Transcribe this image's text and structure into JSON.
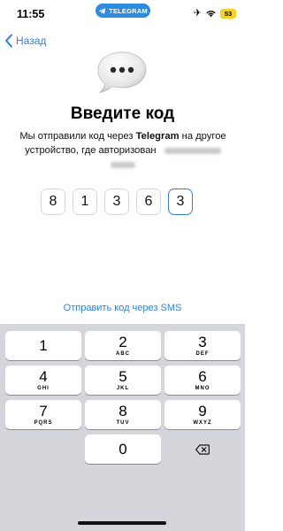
{
  "status_bar": {
    "time": "11:55",
    "app_pill": "TELEGRAM",
    "airplane_icon": "airplane-icon",
    "battery": "53",
    "accent": "#2d8ce0"
  },
  "nav": {
    "back_label": "Назад"
  },
  "main": {
    "title": "Введите код",
    "desc_prefix": "Мы отправили код через ",
    "desc_app": "Telegram",
    "desc_suffix": " на другое устройство, где авторизован",
    "code_digits": [
      "8",
      "1",
      "3",
      "6",
      "3"
    ],
    "sms_link": "Отправить код через SMS"
  },
  "keyboard": {
    "keys": [
      {
        "num": "1",
        "sub": ""
      },
      {
        "num": "2",
        "sub": "ABC"
      },
      {
        "num": "3",
        "sub": "DEF"
      },
      {
        "num": "4",
        "sub": "GHI"
      },
      {
        "num": "5",
        "sub": "JKL"
      },
      {
        "num": "6",
        "sub": "MNO"
      },
      {
        "num": "7",
        "sub": "PQRS"
      },
      {
        "num": "8",
        "sub": "TUV"
      },
      {
        "num": "9",
        "sub": "WXYZ"
      },
      {
        "num": "0",
        "sub": ""
      }
    ],
    "delete_icon": "backspace-icon"
  }
}
